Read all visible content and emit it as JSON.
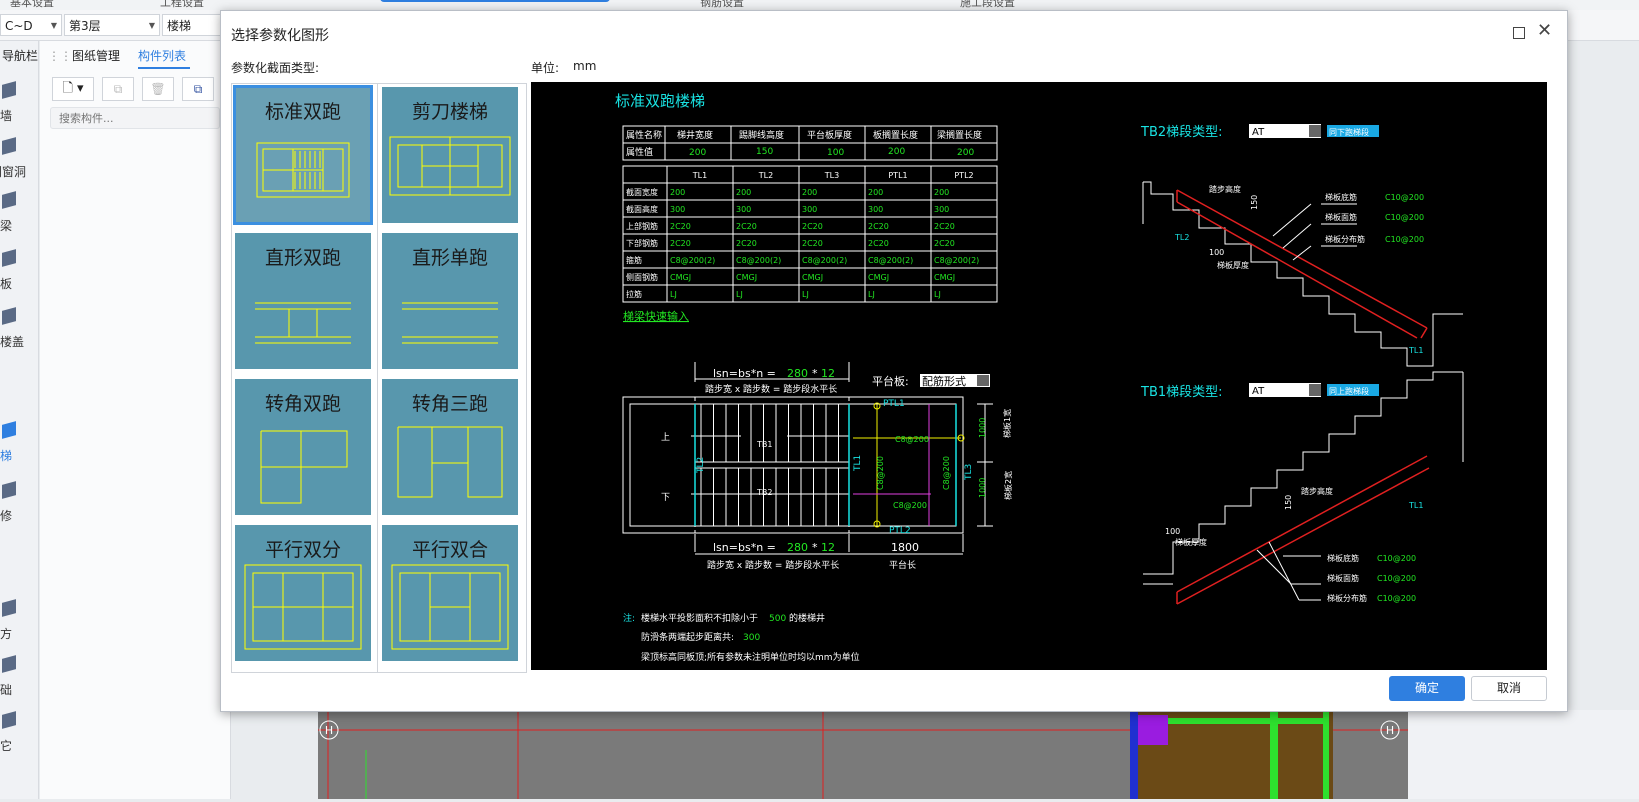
{
  "app": {
    "topbar_tabs": [
      "基本设置",
      "工程设置",
      "钢筋设置",
      "施工段设置"
    ],
    "combos": [
      {
        "value": "C~D"
      },
      {
        "value": "第3层"
      },
      {
        "value": "楼梯"
      }
    ],
    "left_nav_items": [
      "导航栏",
      "墙",
      "门窗洞",
      "梁",
      "板",
      "空心楼盖",
      "楼梯",
      "装修",
      "土方",
      "基础",
      "其它"
    ],
    "panel_tabs": [
      "图纸管理",
      "构件列表"
    ],
    "search_placeholder": "搜索构件...",
    "canvas_marks": [
      "H",
      "H"
    ]
  },
  "dialog": {
    "title": "选择参数化图形",
    "type_label": "参数化截面类型:",
    "unit_label": "单位:",
    "unit_value": "mm",
    "ok_label": "确定",
    "cancel_label": "取消",
    "selected_index": 0,
    "shapes": [
      {
        "label": "标准双跑"
      },
      {
        "label": "剪刀楼梯"
      },
      {
        "label": "直形双跑"
      },
      {
        "label": "直形单跑"
      },
      {
        "label": "转角双跑"
      },
      {
        "label": "转角三跑"
      },
      {
        "label": "平行双分"
      },
      {
        "label": "平行双合"
      }
    ]
  },
  "preview": {
    "title": "标准双跑楼梯",
    "prop_table": {
      "headers": [
        "属性名称",
        "梯井宽度",
        "踢脚线高度",
        "平台板厚度",
        "板搁置长度",
        "梁搁置长度"
      ],
      "values": [
        "属性值",
        "200",
        "150",
        "100",
        "200",
        "200"
      ]
    },
    "beam_table": {
      "headers": [
        "",
        "TL1",
        "TL2",
        "TL3",
        "PTL1",
        "PTL2"
      ],
      "rows": [
        [
          "截面宽度",
          "200",
          "200",
          "200",
          "200",
          "200"
        ],
        [
          "截面高度",
          "300",
          "300",
          "300",
          "300",
          "300"
        ],
        [
          "上部钢筋",
          "2C20",
          "2C20",
          "2C20",
          "2C20",
          "2C20"
        ],
        [
          "下部钢筋",
          "2C20",
          "2C20",
          "2C20",
          "2C20",
          "2C20"
        ],
        [
          "箍筋",
          "C8@200(2)",
          "C8@200(2)",
          "C8@200(2)",
          "C8@200(2)",
          "C8@200(2)"
        ],
        [
          "侧面钢筋",
          "CMGJ",
          "CMGJ",
          "CMGJ",
          "CMGJ",
          "CMGJ"
        ],
        [
          "拉筋",
          "LJ",
          "LJ",
          "LJ",
          "LJ",
          "LJ"
        ]
      ]
    },
    "quick_input": "梯梁快速输入",
    "plan": {
      "lsn_top": "lsn=bs*n =",
      "step_width": "280",
      "star": "*",
      "step_count": "12",
      "step_note": "踏步宽 x 踏步数 = 踏步段水平长",
      "platform_label": "平台板:",
      "platform_value": "配筋形式",
      "platform_len": "1800",
      "platform_len_label": "平台长",
      "up": "上",
      "down": "下",
      "tb1": "TB1",
      "tb2": "TB2",
      "ptl1": "PTL1",
      "ptl2": "PTL2",
      "tl1": "TL1",
      "tl2": "TL2",
      "tl3": "TL3",
      "rebar1": "C8@200",
      "rebar2": "C8@200",
      "rebar3": "C8@200",
      "rebar4": "C8@200",
      "dim1000a": "1000",
      "dim1000b": "1000",
      "width1": "梯板1宽",
      "width2": "梯板2宽"
    },
    "notes": {
      "prefix": "注:",
      "line1a": "楼梯水平投影面积不扣除小于",
      "line1v": "500",
      "line1b": "的楼梯井",
      "line2a": "防滑条两端起步距离共:",
      "line2v": "300",
      "line3": "梁顶标高同板顶;所有参数未注明单位时均以mm为单位"
    },
    "tb2": {
      "label": "TB2梯段类型:",
      "value": "AT",
      "link": "同下跑梯段",
      "step_height": "踏步高度",
      "h150": "150",
      "bottom_rebar": "梯板底筋",
      "bottom_val": "C10@200",
      "face_rebar": "梯板面筋",
      "face_val": "C10@200",
      "dist_rebar": "梯板分布筋",
      "dist_val": "C10@200",
      "thick": "100",
      "thick_label": "梯板厚度",
      "tl_a": "TL2",
      "tl_b": "TL1"
    },
    "tb1": {
      "label": "TB1梯段类型:",
      "value": "AT",
      "link": "同上跑梯段",
      "step_height": "踏步高度",
      "h150": "150",
      "bottom_rebar": "梯板底筋",
      "bottom_val": "C10@200",
      "face_rebar": "梯板面筋",
      "face_val": "C10@200",
      "dist_rebar": "梯板分布筋",
      "dist_val": "C10@200",
      "thick": "100",
      "thick_label": "梯板厚度",
      "tl_b": "TL1"
    },
    "colors": {
      "cyan": "#19e3e3",
      "green": "#22e622",
      "white": "#ffffff",
      "yellow": "#f2f200",
      "magenta": "#e040e0",
      "red": "#e02020"
    }
  }
}
